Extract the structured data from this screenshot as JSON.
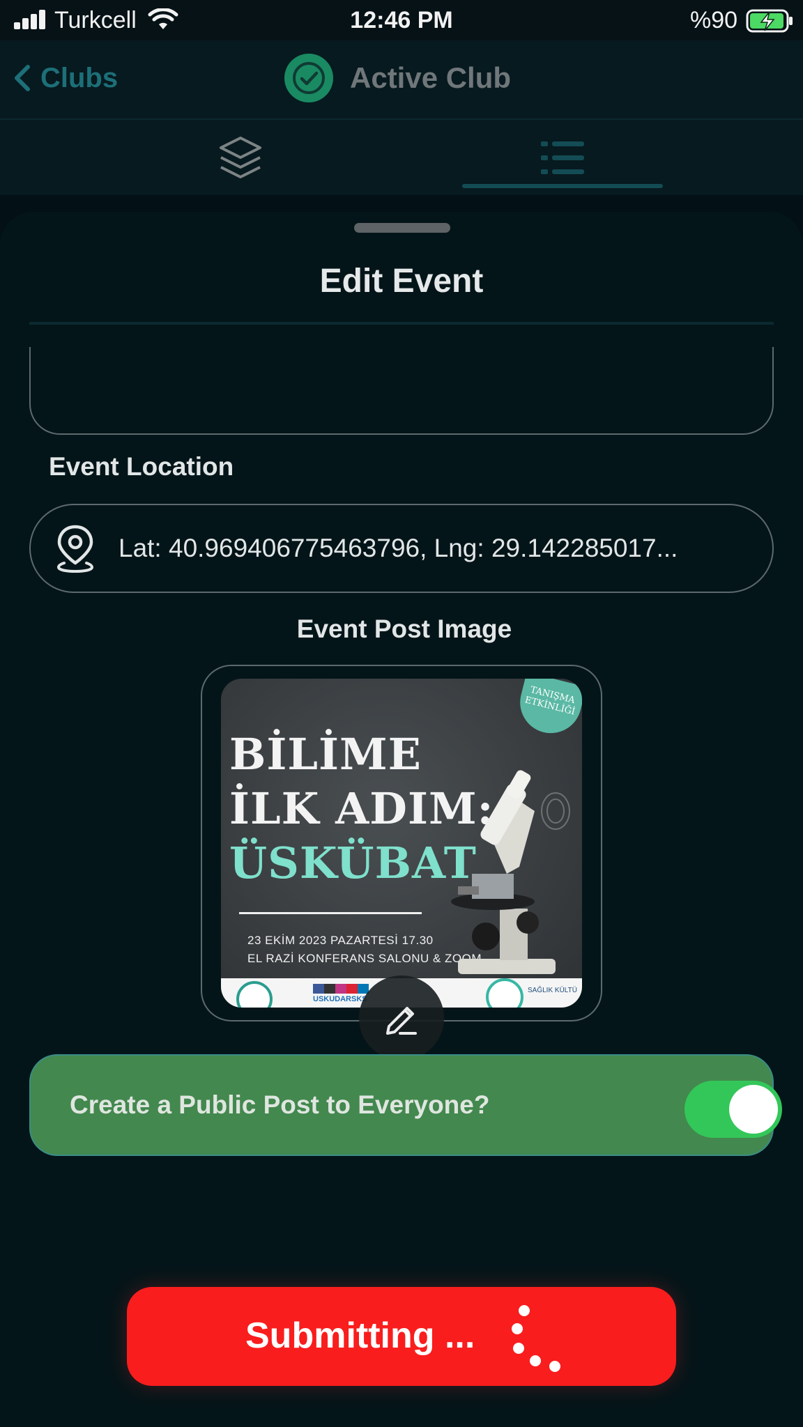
{
  "status_bar": {
    "carrier": "Turkcell",
    "time": "12:46 PM",
    "battery_text": "%90"
  },
  "nav": {
    "back_label": "Clubs",
    "title": "Active Club"
  },
  "tabs": [
    {
      "icon": "layers-icon"
    },
    {
      "icon": "list-icon",
      "active": true
    }
  ],
  "sheet": {
    "title": "Edit Event",
    "location_label": "Event Location",
    "location_value": "Lat: 40.969406775463796, Lng: 29.142285017...",
    "image_label": "Event Post Image",
    "public_post_label": "Create a Public Post to Everyone?",
    "public_post_enabled": true,
    "submit_label": "Submitting ..."
  },
  "poster": {
    "line1": "BİLİME",
    "line2": "İLK ADIM:",
    "line3": "ÜSKÜBAT",
    "date": "23 EKİM 2023 PAZARTESİ 17.30",
    "venue": "EL RAZİ KONFERANS SALONU & ZOOM",
    "badge": "TANIŞMA ETKİNLİĞİ",
    "footer_name": "USKUDARSKS",
    "footer_small": "SAĞLIK KÜLTÜ"
  },
  "colors": {
    "accent_teal": "#1d6f78",
    "public_card": "#43884e",
    "toggle_on": "#33c759",
    "submit": "#f91d1d"
  }
}
